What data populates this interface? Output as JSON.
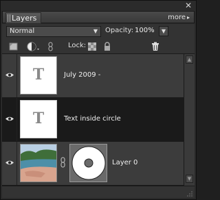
{
  "window": {
    "close_glyph": "✕"
  },
  "header": {
    "tab_label": "Layers",
    "more_label": "more",
    "more_glyph": "▸"
  },
  "controls": {
    "blend_mode": "Normal",
    "opacity_label": "Opacity:",
    "opacity_value": "100%",
    "lock_label": "Lock:"
  },
  "layers": [
    {
      "name": "July 2009  -",
      "thumb_letter": "T",
      "visible": true,
      "selected": false
    },
    {
      "name": "Text inside circle",
      "thumb_letter": "T",
      "visible": true,
      "selected": true
    },
    {
      "name": "Layer 0",
      "visible": true,
      "selected": false,
      "has_mask": true
    }
  ],
  "colors": {
    "panel_bg": "#2a2a2a",
    "selected_row": "#1a1a1a",
    "row_bg": "#3c3c3c"
  }
}
